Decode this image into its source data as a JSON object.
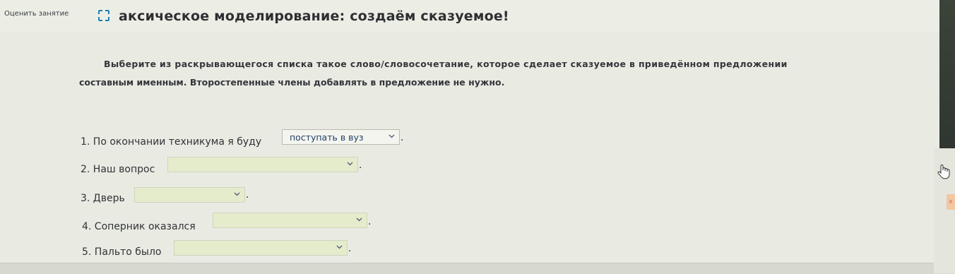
{
  "header": {
    "rate_label": "Оценить занятие",
    "title": "аксическое моделирование: создаём сказуемое!"
  },
  "instruction": {
    "line1": "Выберите из раскрывающегося списка такое слово/словосочетание, которое сделает сказуемое в приведённом предложении",
    "line2": "составным именным. Второстепенные члены добавлять в предложение не нужно."
  },
  "tasks": [
    {
      "text": "1. По окончании техникума я буду",
      "selected": "поступать в вуз",
      "end": "."
    },
    {
      "text": "2. Наш вопрос",
      "selected": "",
      "end": "."
    },
    {
      "text": "3. Дверь",
      "selected": "",
      "end": "."
    },
    {
      "text": "4. Соперник оказался",
      "selected": "",
      "end": "."
    },
    {
      "text": "5. Пальто было",
      "selected": "",
      "end": "."
    }
  ],
  "side": {
    "mark": "x"
  },
  "icons": {
    "fullscreen": "expand-icon",
    "chevron": "chevron-down-icon",
    "hand": "hand-pointer-icon"
  },
  "colors": {
    "dropdown_empty": "#e5eccb",
    "dropdown_text": "#25406a"
  }
}
